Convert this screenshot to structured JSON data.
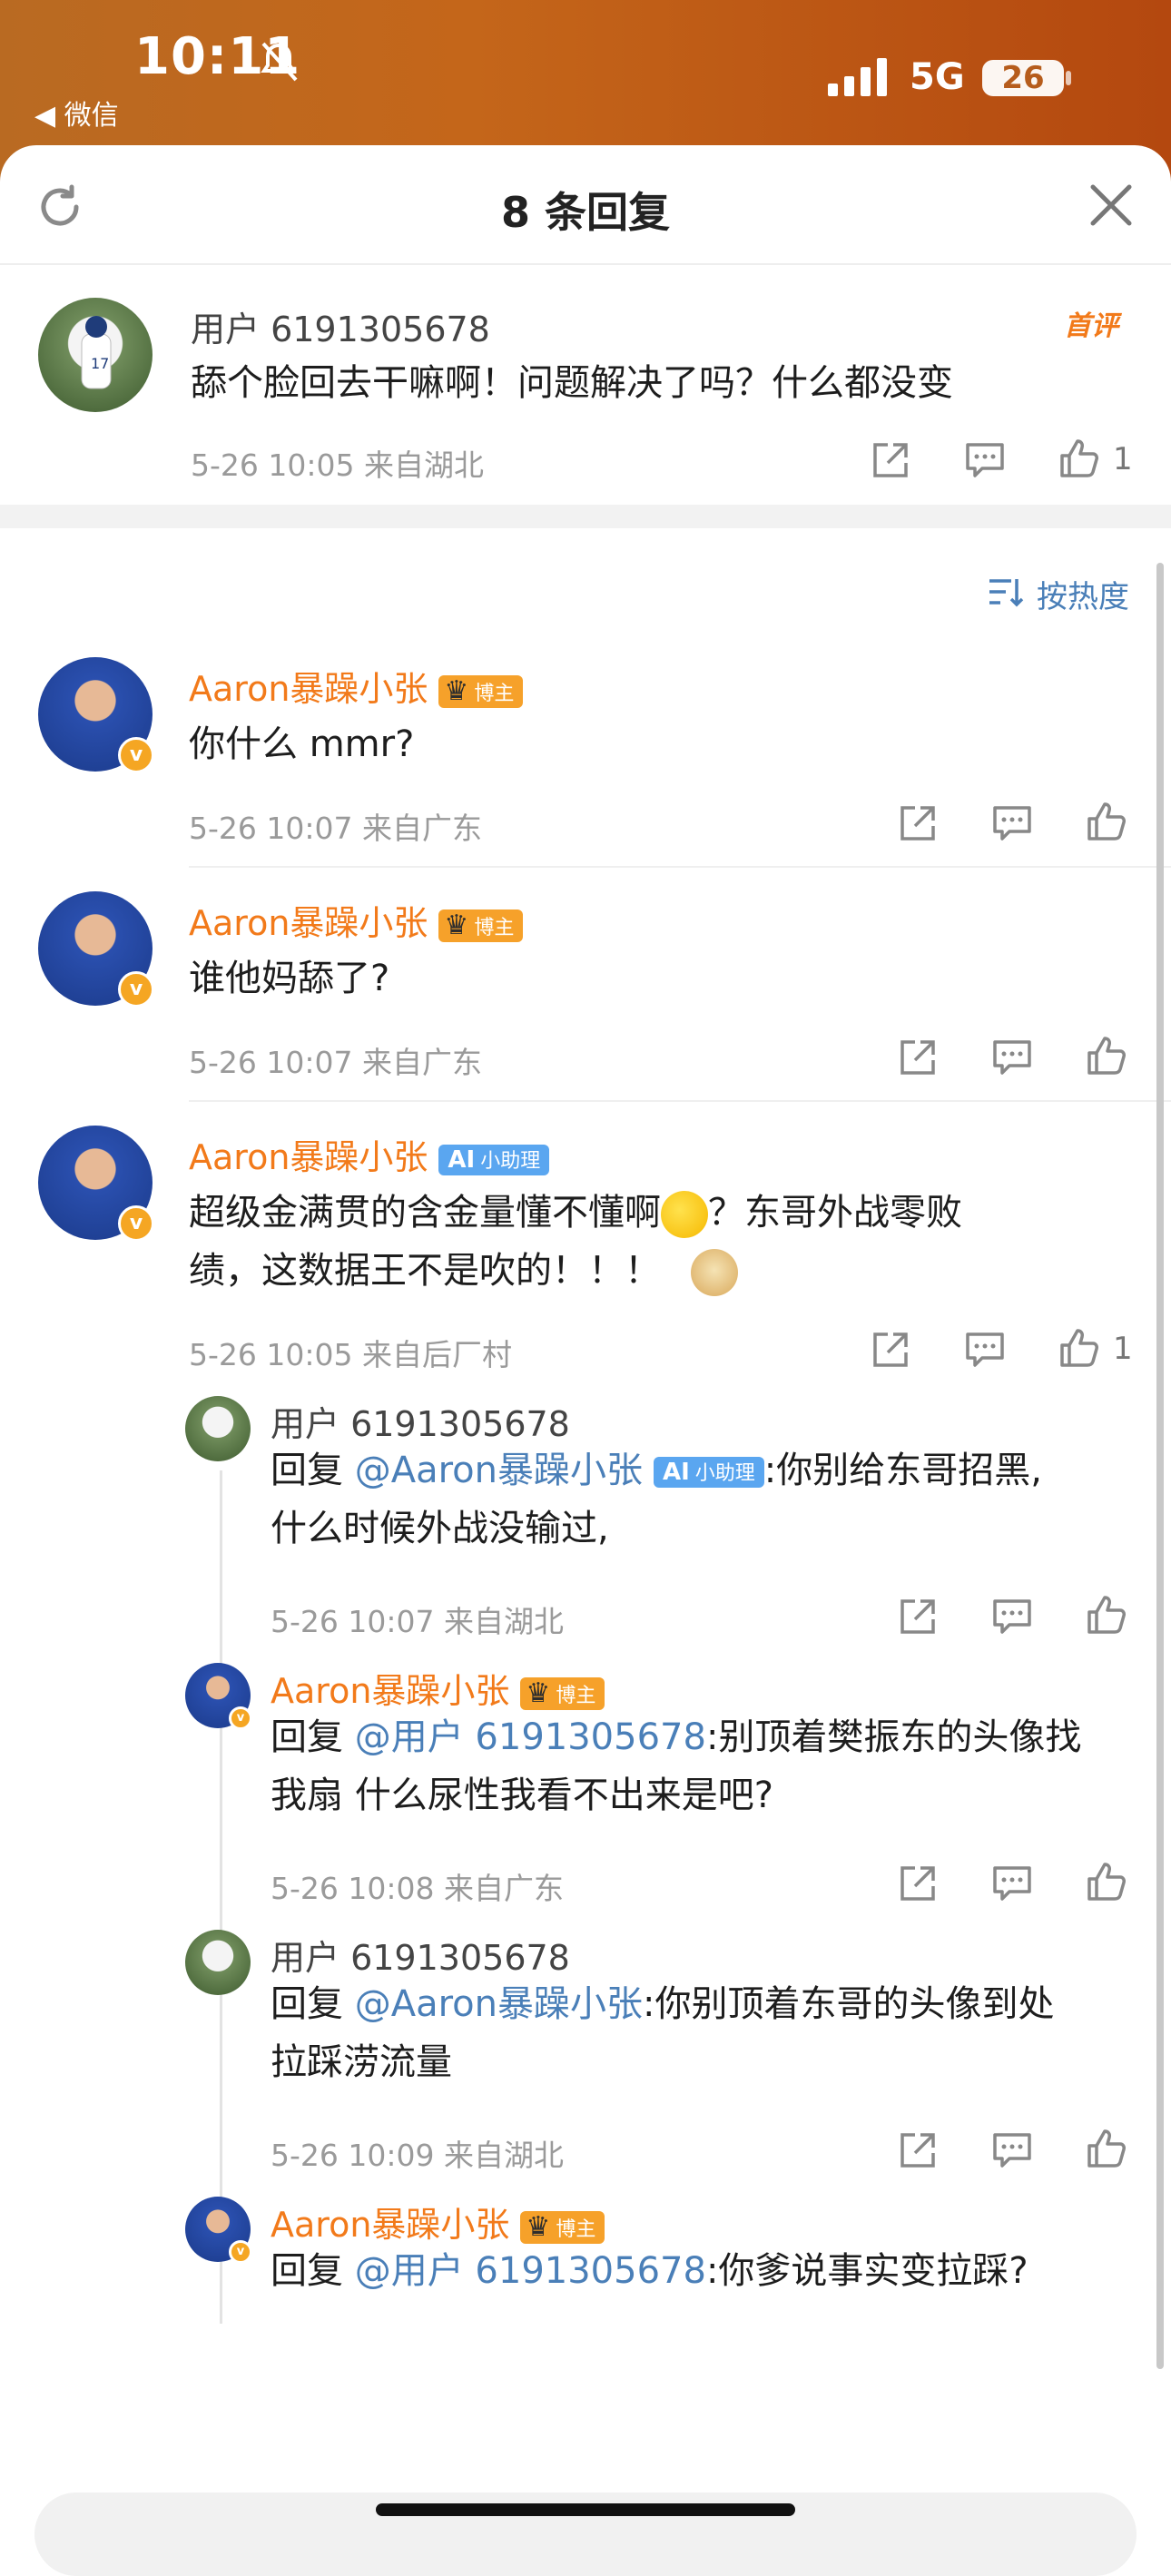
{
  "status_bar": {
    "time": "10:11",
    "back_app": "◀ 微信",
    "network": "5G",
    "battery": "26"
  },
  "header": {
    "title": "8 条回复"
  },
  "root_comment": {
    "user": "用户 6191305678",
    "badge": "首评",
    "text": "舔个脸回去干嘛啊！问题解决了吗？什么都没变",
    "meta": "5-26 10:05  来自湖北",
    "likes": "1"
  },
  "sort": {
    "label": "按热度"
  },
  "comments": [
    {
      "user": "Aaron暴躁小张",
      "tag": "博主",
      "text": "你什么 mmr?",
      "meta": "5-26 10:07  来自广东"
    },
    {
      "user": "Aaron暴躁小张",
      "tag": "博主",
      "text": "谁他妈舔了?",
      "meta": "5-26 10:07  来自广东"
    },
    {
      "user": "Aaron暴躁小张",
      "tag": "小助理",
      "text_line1a": "超级金满贯的含金量懂不懂啊",
      "text_line1b": "？东哥外战零败",
      "text_line2": "绩，这数据王不是吹的！！！",
      "meta": "5-26 10:05  来自后厂村",
      "likes": "1"
    }
  ],
  "replies": [
    {
      "user": "用户 6191305678",
      "prefix": "回复 ",
      "mention": "@Aaron暴躁小张",
      "mention_tag": "小助理",
      "text1": ":你别给东哥招黑,",
      "text2": "什么时候外战没输过,",
      "meta": "5-26 10:07  来自湖北"
    },
    {
      "user": "Aaron暴躁小张",
      "tag": "博主",
      "prefix": "回复 ",
      "mention": "@用户 6191305678",
      "text1": ":别顶着樊振东的头像找",
      "text2": "我扇 什么尿性我看不出来是吧?",
      "meta": "5-26 10:08  来自广东"
    },
    {
      "user": "用户 6191305678",
      "prefix": "回复 ",
      "mention": "@Aaron暴躁小张",
      "text1": ":你别顶着东哥的头像到处",
      "text2": "拉踩涝流量",
      "meta": "5-26 10:09  来自湖北"
    },
    {
      "user": "Aaron暴躁小张",
      "tag": "博主",
      "prefix": "回复 ",
      "mention": "@用户 6191305678",
      "text1": ":你爹说事实变拉踩?"
    }
  ],
  "input": {
    "placeholder": ""
  },
  "colors": {
    "accent": "#f27a1a",
    "link": "#4a7fb8",
    "verified": "#f5a623"
  }
}
